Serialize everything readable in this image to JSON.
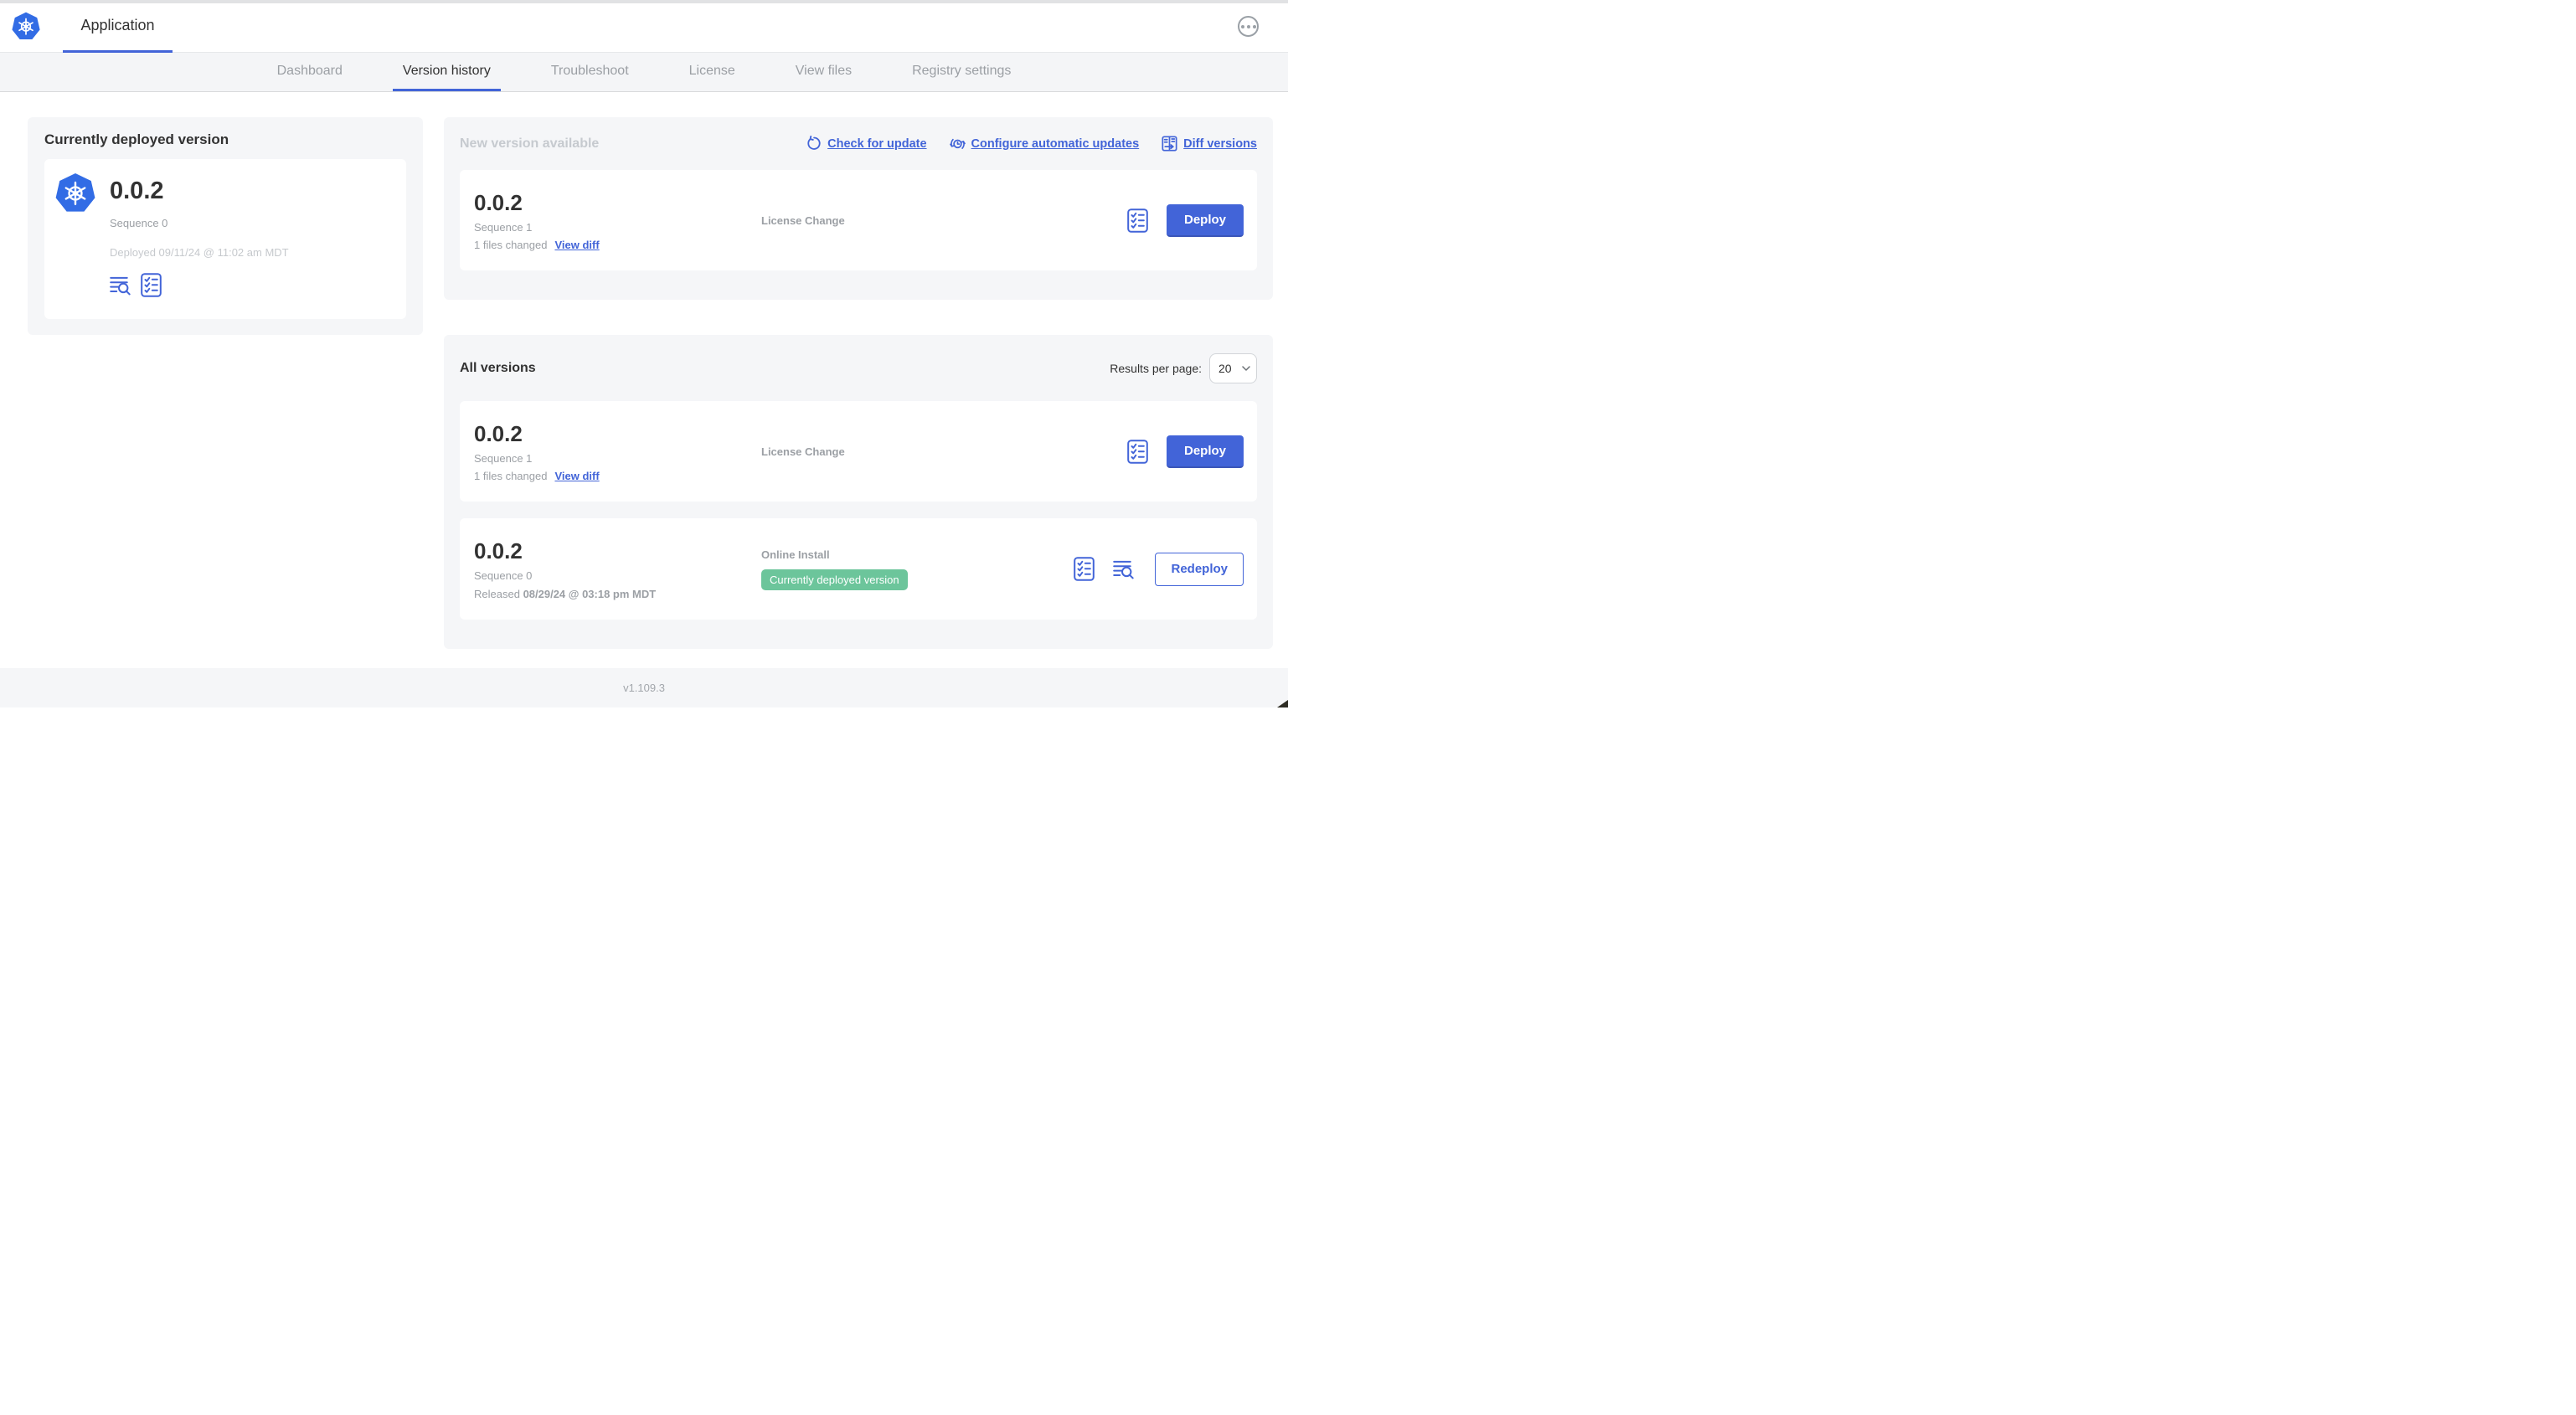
{
  "header": {
    "app_title": "Application",
    "more_menu_icon": "ellipsis-icon"
  },
  "nav": {
    "tabs": [
      {
        "label": "Dashboard",
        "active": false
      },
      {
        "label": "Version history",
        "active": true
      },
      {
        "label": "Troubleshoot",
        "active": false
      },
      {
        "label": "License",
        "active": false
      },
      {
        "label": "View files",
        "active": false
      },
      {
        "label": "Registry settings",
        "active": false
      }
    ]
  },
  "current_version_panel": {
    "title": "Currently deployed version",
    "version": "0.0.2",
    "sequence": "Sequence 0",
    "deployed_at": "Deployed 09/11/24 @ 11:02 am MDT",
    "icons": [
      "view-logs-icon",
      "config-checklist-icon"
    ]
  },
  "new_version_panel": {
    "title": "New version available",
    "actions": {
      "check_for_update": "Check for update",
      "configure_automatic_updates": "Configure automatic updates",
      "diff_versions": "Diff versions"
    },
    "action_icons": [
      "refresh-icon",
      "scheduled-update-icon",
      "diff-icon"
    ],
    "card": {
      "version": "0.0.2",
      "sequence": "Sequence 1",
      "files_changed": "1 files changed",
      "view_diff": "View diff",
      "source": "License Change",
      "deploy_label": "Deploy"
    }
  },
  "all_versions_panel": {
    "title": "All versions",
    "results_per_page_label": "Results per page:",
    "results_per_page_value": "20",
    "rows": [
      {
        "version": "0.0.2",
        "sequence": "Sequence 1",
        "files_changed": "1 files changed",
        "view_diff": "View diff",
        "source": "License Change",
        "action_label": "Deploy"
      },
      {
        "version": "0.0.2",
        "sequence": "Sequence 0",
        "released_prefix": "Released",
        "released_date": "08/29/24 @ 03:18 pm MDT",
        "source": "Online Install",
        "badge": "Currently deployed version",
        "action_label": "Redeploy"
      }
    ]
  },
  "footer": {
    "app_version": "v1.109.3"
  },
  "colors": {
    "accent_blue": "#4264d8",
    "k8s_logo_blue": "#326ce5",
    "badge_green": "#6cc59b",
    "panel_bg": "#f5f6f8",
    "muted_text": "#9b9fa4"
  }
}
